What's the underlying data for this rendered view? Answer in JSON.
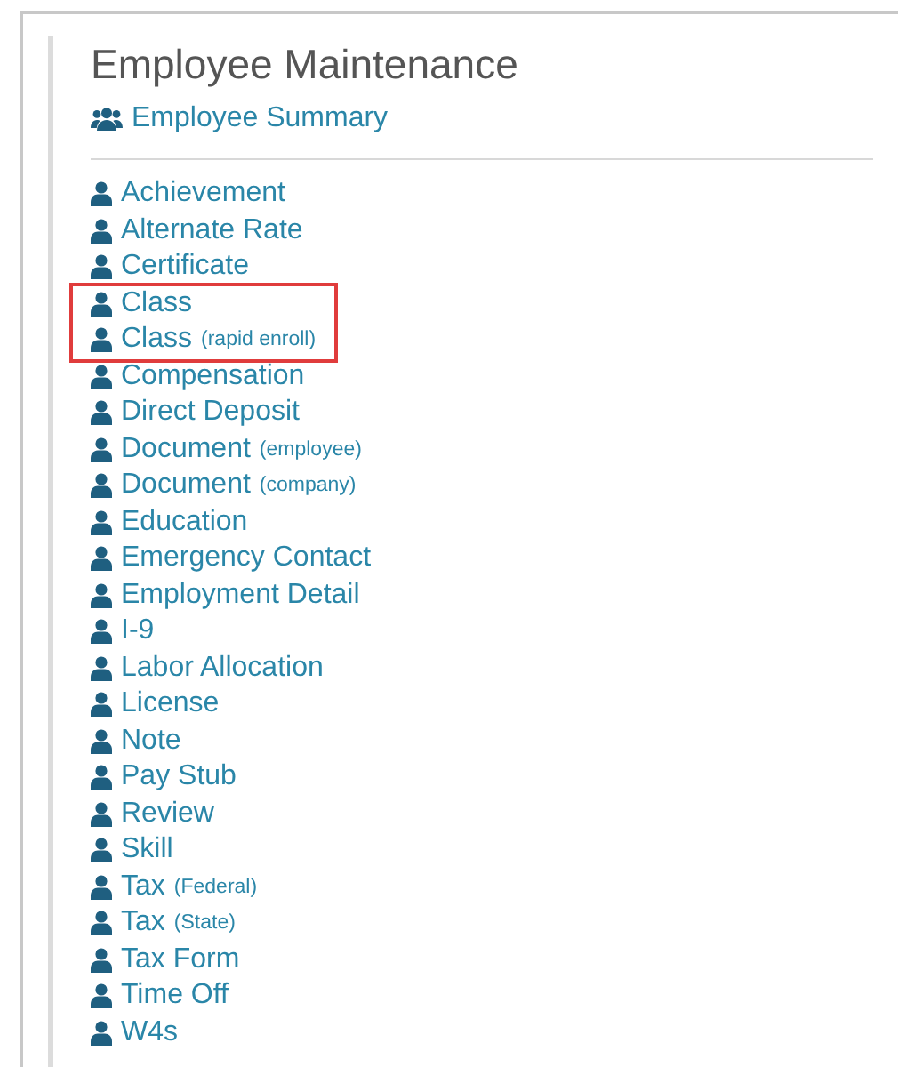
{
  "title": "Employee Maintenance",
  "summary_link": {
    "label": "Employee Summary"
  },
  "items": [
    {
      "label": "Achievement",
      "highlighted": false
    },
    {
      "label": "Alternate Rate",
      "highlighted": false
    },
    {
      "label": "Certificate",
      "highlighted": false
    },
    {
      "label": "Class",
      "highlighted": true
    },
    {
      "label": "Class",
      "note": "(rapid enroll)",
      "highlighted": true
    },
    {
      "label": "Compensation",
      "highlighted": false
    },
    {
      "label": "Direct Deposit",
      "highlighted": false
    },
    {
      "label": "Document",
      "note": "(employee)",
      "highlighted": false
    },
    {
      "label": "Document",
      "note": "(company)",
      "highlighted": false
    },
    {
      "label": "Education",
      "highlighted": false
    },
    {
      "label": "Emergency Contact",
      "highlighted": false
    },
    {
      "label": "Employment Detail",
      "highlighted": false
    },
    {
      "label": "I-9",
      "highlighted": false
    },
    {
      "label": "Labor Allocation",
      "highlighted": false
    },
    {
      "label": "License",
      "highlighted": false
    },
    {
      "label": "Note",
      "highlighted": false
    },
    {
      "label": "Pay Stub",
      "highlighted": false
    },
    {
      "label": "Review",
      "highlighted": false
    },
    {
      "label": "Skill",
      "highlighted": false
    },
    {
      "label": "Tax",
      "note": "(Federal)",
      "highlighted": false
    },
    {
      "label": "Tax",
      "note": "(State)",
      "highlighted": false
    },
    {
      "label": "Tax Form",
      "highlighted": false
    },
    {
      "label": "Time Off",
      "highlighted": false
    },
    {
      "label": "W4s",
      "highlighted": false
    }
  ]
}
